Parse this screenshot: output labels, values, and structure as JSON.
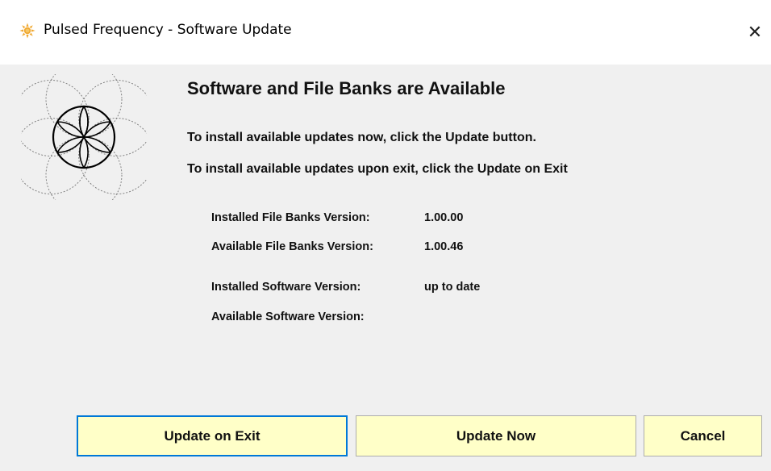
{
  "window": {
    "title": "Pulsed Frequency - Software Update",
    "close_glyph": "✕",
    "icon": "app-sun-icon",
    "accent_color": "#0078d7",
    "button_color": "#ffffc8"
  },
  "main": {
    "heading": "Software and File Banks are Available",
    "instruction_now": "To install available updates now, click the Update button.",
    "instruction_exit": "To install available updates upon exit, click the Update on Exit"
  },
  "versions": [
    {
      "label": "Installed File Banks Version:",
      "value": "1.00.00"
    },
    {
      "label": "Available File Banks Version:",
      "value": "1.00.46"
    },
    {
      "label": "Installed Software Version:",
      "value": "up to date"
    },
    {
      "label": "Available Software Version:",
      "value": ""
    }
  ],
  "buttons": {
    "update_on_exit": "Update on Exit",
    "update_now": "Update Now",
    "cancel": "Cancel"
  },
  "logo": "flower-of-life-icon"
}
